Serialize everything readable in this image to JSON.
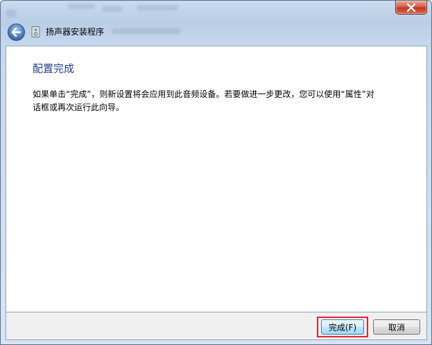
{
  "window": {
    "title": "扬声器安装程序"
  },
  "page": {
    "heading": "配置完成",
    "description": "如果单击“完成”，则新设置将会应用到此音频设备。若要做进一步更改，您可以使用“属性”对话框或再次运行此向导。"
  },
  "buttons": {
    "finish_label": "完成(F)",
    "cancel_label": "取消"
  },
  "icons": {
    "close": "close-icon",
    "back": "back-arrow-icon",
    "app": "speaker-setup-icon"
  },
  "colors": {
    "heading": "#1e3e8a",
    "highlight_border": "#e5232d",
    "close_button": "#c4361f"
  }
}
